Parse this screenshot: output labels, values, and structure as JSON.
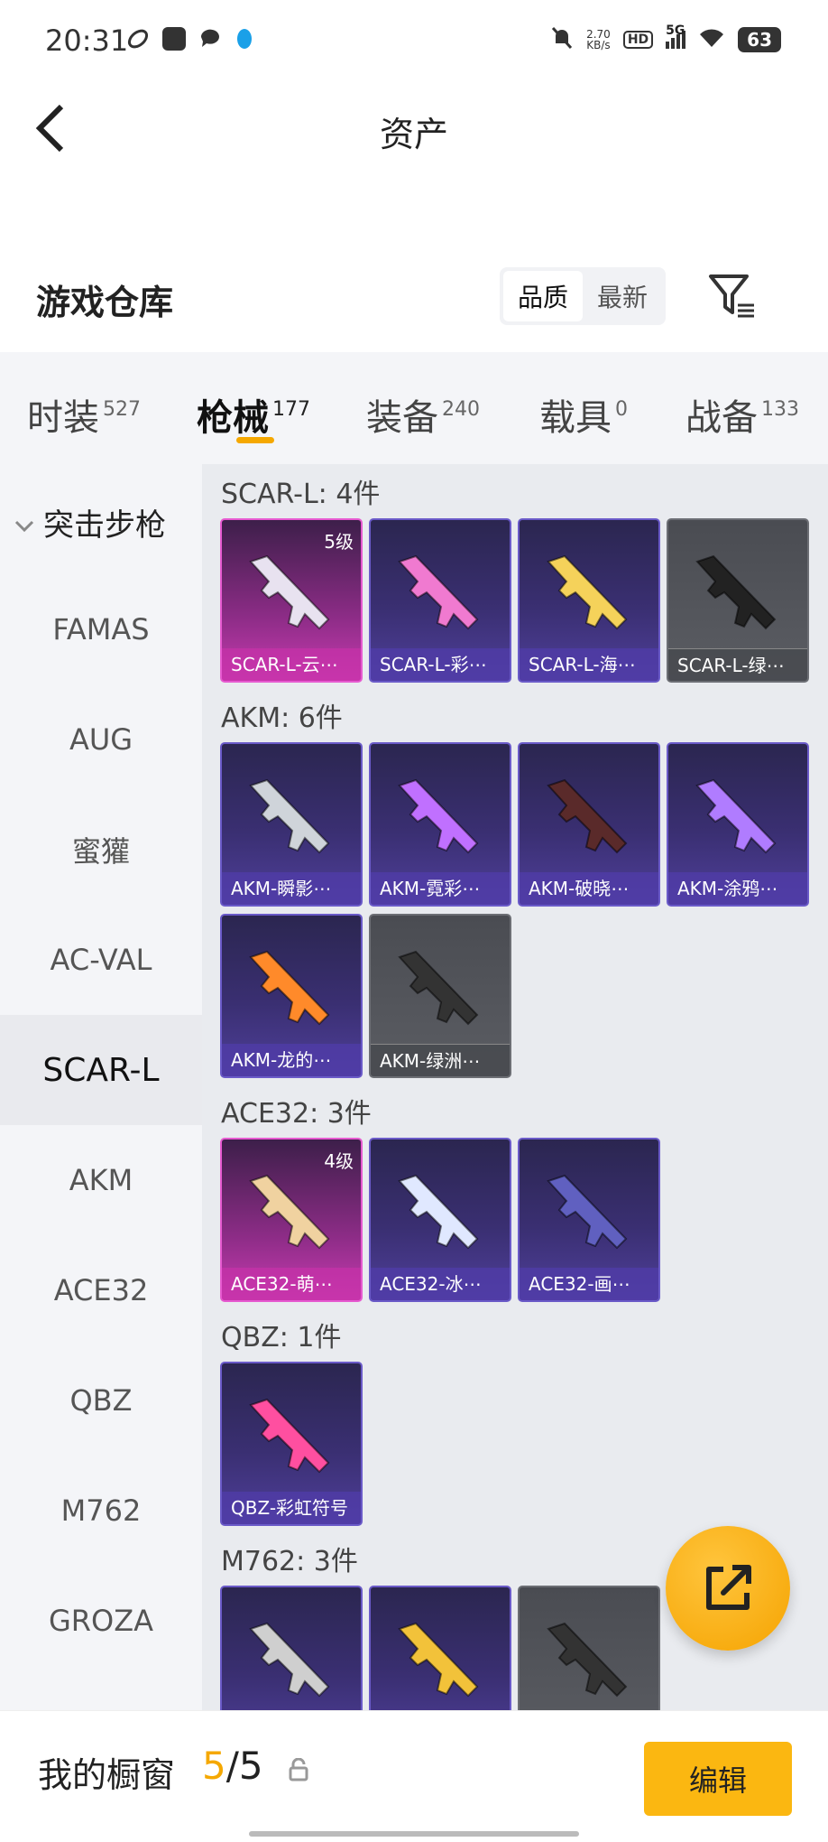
{
  "status_bar": {
    "time": "20:31",
    "net_speed_value": "2.70",
    "net_speed_unit": "KB/s",
    "hd_badge": "HD",
    "network": "5G",
    "battery": "63",
    "left_icons": [
      "feather-icon",
      "message-box-icon",
      "chat-bubble-icon",
      "qq-penguin-icon"
    ],
    "right_icons": [
      "mute-bell-icon",
      "signal-icon",
      "wifi-icon",
      "battery-icon"
    ]
  },
  "header": {
    "title": "资产",
    "back_icon": "chevron-left-icon"
  },
  "warehouse": {
    "title": "游戏仓库",
    "sort_options": [
      "品质",
      "最新"
    ],
    "sort_selected": "品质",
    "filter_icon": "filter-list-icon"
  },
  "tabs": [
    {
      "label": "时装",
      "count": "527"
    },
    {
      "label": "枪械",
      "count": "177"
    },
    {
      "label": "装备",
      "count": "240"
    },
    {
      "label": "载具",
      "count": "0"
    },
    {
      "label": "战备",
      "count": "133"
    }
  ],
  "active_tab": "枪械",
  "sidebar": {
    "group": "突击步枪",
    "items": [
      "FAMAS",
      "AUG",
      "蜜獾",
      "AC-VAL",
      "SCAR-L",
      "AKM",
      "ACE32",
      "QBZ",
      "M762",
      "GROZA"
    ],
    "active": "SCAR-L"
  },
  "groups": [
    {
      "title": "SCAR-L: 4件",
      "items": [
        {
          "label": "SCAR-L-云⋯",
          "level": "5级",
          "style": "pink"
        },
        {
          "label": "SCAR-L-彩⋯",
          "level": "",
          "style": "purple"
        },
        {
          "label": "SCAR-L-海⋯",
          "level": "",
          "style": "purple"
        },
        {
          "label": "SCAR-L-绿⋯",
          "level": "",
          "style": "gray"
        }
      ]
    },
    {
      "title": "AKM: 6件",
      "items": [
        {
          "label": "AKM-瞬影⋯",
          "level": "",
          "style": "purple"
        },
        {
          "label": "AKM-霓彩⋯",
          "level": "",
          "style": "purple"
        },
        {
          "label": "AKM-破晓⋯",
          "level": "",
          "style": "purple"
        },
        {
          "label": "AKM-涂鸦⋯",
          "level": "",
          "style": "purple"
        },
        {
          "label": "AKM-龙的⋯",
          "level": "",
          "style": "purple"
        },
        {
          "label": "AKM-绿洲⋯",
          "level": "",
          "style": "gray"
        }
      ]
    },
    {
      "title": "ACE32: 3件",
      "items": [
        {
          "label": "ACE32-萌⋯",
          "level": "4级",
          "style": "pink"
        },
        {
          "label": "ACE32-冰⋯",
          "level": "",
          "style": "purple"
        },
        {
          "label": "ACE32-画⋯",
          "level": "",
          "style": "purple"
        }
      ]
    },
    {
      "title": "QBZ: 1件",
      "items": [
        {
          "label": "QBZ-彩虹符号",
          "level": "",
          "style": "purple"
        }
      ]
    },
    {
      "title": "M762: 3件",
      "items": [
        {
          "label": "",
          "level": "",
          "style": "purple"
        },
        {
          "label": "",
          "level": "",
          "style": "purple"
        },
        {
          "label": "",
          "level": "",
          "style": "gray"
        }
      ]
    }
  ],
  "fab_icon": "share-external-icon",
  "bottom_bar": {
    "showcase_label": "我的橱窗",
    "showcase_current": "5",
    "showcase_separator": "/",
    "showcase_total": "5",
    "lock_icon": "lock-icon",
    "edit_label": "编辑"
  },
  "colors": {
    "accent": "#f5a800",
    "edit_button": "#fbb711",
    "pink_rarity": "#e65ad0",
    "purple_rarity": "#6a5ac8",
    "gray_rarity": "#6c6e74"
  }
}
